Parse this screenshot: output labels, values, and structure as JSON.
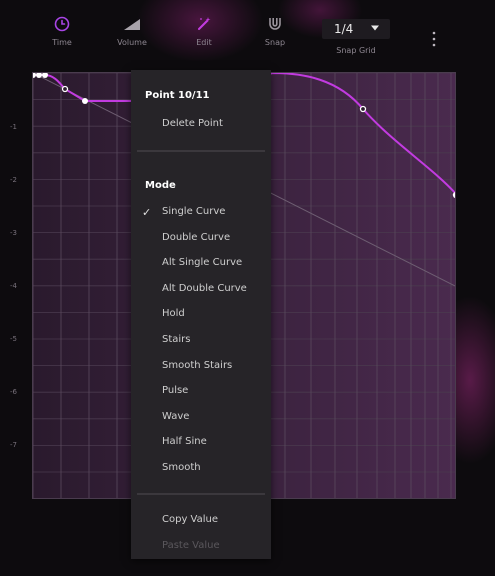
{
  "toolbar": {
    "time_label": "Time",
    "volume_label": "Volume",
    "edit_label": "Edit",
    "snap_label": "Snap",
    "snap_grid_value": "1/4",
    "snap_grid_label": "Snap Grid",
    "accent_color": "#a845e6",
    "icon_color": "#9a949c"
  },
  "plot": {
    "y_ticks": [
      "-1",
      "-2",
      "-3",
      "-4",
      "-5",
      "-6",
      "-7"
    ],
    "curve_color": "#c23be0",
    "point_count_total": 11
  },
  "context_menu": {
    "point_header": "Point 10/11",
    "delete_point": "Delete Point",
    "mode_header": "Mode",
    "modes": [
      "Single Curve",
      "Double Curve",
      "Alt Single Curve",
      "Alt Double Curve",
      "Hold",
      "Stairs",
      "Smooth Stairs",
      "Pulse",
      "Wave",
      "Half Sine",
      "Smooth"
    ],
    "selected_mode": "Single Curve",
    "copy_value": "Copy Value",
    "paste_value": "Paste Value"
  }
}
